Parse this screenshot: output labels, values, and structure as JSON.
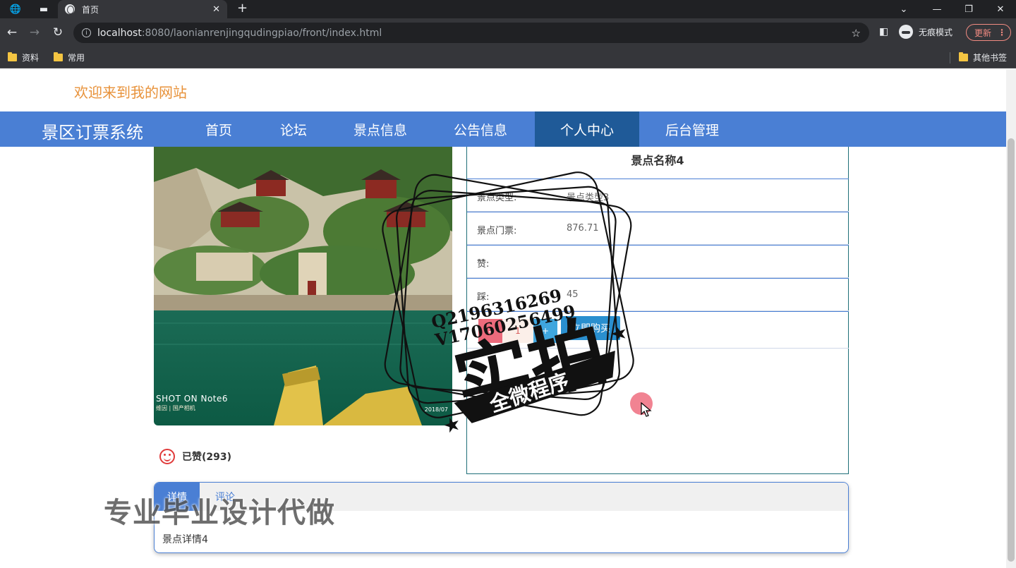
{
  "browser": {
    "tab_title": "首页",
    "url_host": "localhost",
    "url_path": ":8080/laonianrenjingqudingpiao/front/index.html",
    "incognito_label": "无痕模式",
    "update_label": "更新",
    "bookmarks": [
      "资料",
      "常用"
    ],
    "other_bookmarks": "其他书签"
  },
  "site": {
    "welcome": "欢迎来到我的网站",
    "brand": "景区订票系统",
    "nav": [
      "首页",
      "论坛",
      "景点信息",
      "公告信息",
      "个人中心",
      "后台管理"
    ],
    "active_nav": "个人中心"
  },
  "photo": {
    "shot_text": "SHOT ON Note6",
    "sub_text": "维因 | 国产相机",
    "date_text": "2018/07"
  },
  "detail": {
    "title": "景点名称4",
    "rows": [
      {
        "key": "景点类型:",
        "value": "景点类型3"
      },
      {
        "key": "景点门票:",
        "value": "876.71"
      },
      {
        "key": "赞:",
        "value": ""
      },
      {
        "key": "踩:",
        "value": "45"
      }
    ],
    "quantity": "1",
    "minus_label": "-",
    "plus_label": "+",
    "buy_label": "立即购买"
  },
  "like": {
    "text": "已赞(293)"
  },
  "tabs": {
    "active": "详情",
    "other": "评论",
    "body": "景点详情4"
  },
  "overlay": {
    "qq": "Q2196316269",
    "wx": "V17060256499",
    "stamp_big": "实拍",
    "stamp_ribbon": "全微程序",
    "promo": "专业毕业设计代做"
  },
  "colors": {
    "nav_bg": "#4a7fd4",
    "nav_active": "#1f5a98",
    "welcome": "#e8923a",
    "buy_button": "#2a8fcf"
  }
}
